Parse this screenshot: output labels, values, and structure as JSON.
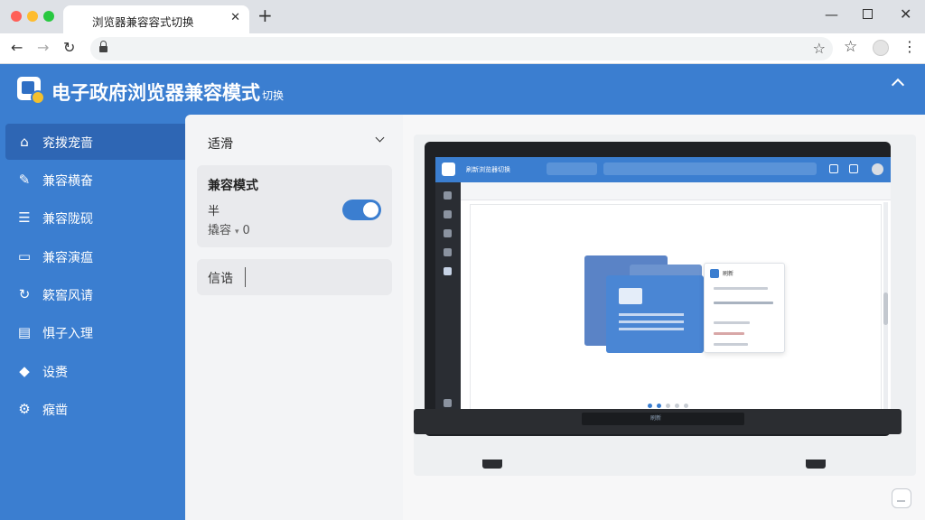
{
  "browser": {
    "tab_title": "浏览器兼容容式切换",
    "tab_close": "✕",
    "new_tab": "+",
    "window_min": "—",
    "window_close": "✕",
    "nav_back": "←",
    "nav_forward": "→",
    "nav_reload": "↻",
    "bookmark": "☆",
    "toolbar_star": "☆",
    "menu": "⋮"
  },
  "header": {
    "title": "电子政府浏览器兼容模式",
    "title_suffix": "切换"
  },
  "sidebar": {
    "items": [
      {
        "label": "兖拨宠啬",
        "icon": "home-icon",
        "glyph": "⌂"
      },
      {
        "label": "兼容横奋",
        "icon": "edit-icon",
        "glyph": "✎"
      },
      {
        "label": "兼容陇砚",
        "icon": "list-icon",
        "glyph": "☰"
      },
      {
        "label": "兼容演瘟",
        "icon": "chat-icon",
        "glyph": "▭"
      },
      {
        "label": "簌窖风请",
        "icon": "refresh-icon",
        "glyph": "↻"
      },
      {
        "label": "惧子入理",
        "icon": "document-icon",
        "glyph": "▤"
      },
      {
        "label": "设赉",
        "icon": "code-icon",
        "glyph": "◆"
      },
      {
        "label": "瘊凿",
        "icon": "gear-icon",
        "glyph": "⚙"
      }
    ]
  },
  "panel": {
    "select_label": "适滑",
    "card_title": "兼容模式",
    "card_line1": "半",
    "card_line2_label": "撬容",
    "card_line2_caret": "▾",
    "card_line2_value": "0",
    "toggle_on": true,
    "input_label": "信诰"
  },
  "preview": {
    "screen_title": "刷新浏览器切换",
    "dialog_title": "刷新",
    "stand_label": "刷新",
    "carousel_dots": 5,
    "carousel_active": 1
  },
  "colors": {
    "brand": "#3b7ed0",
    "sidebar_active": "#2e66b4"
  }
}
